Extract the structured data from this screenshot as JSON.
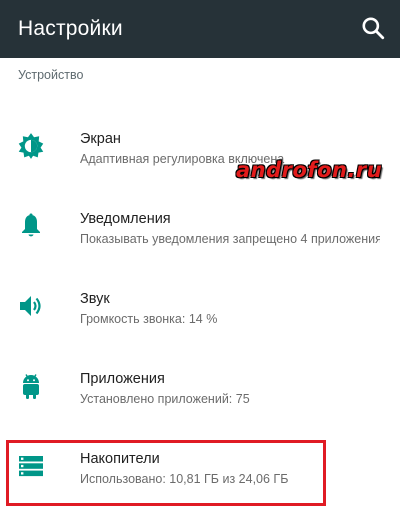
{
  "app_bar": {
    "title": "Настройки",
    "background": "#263238",
    "search_icon": "search-icon"
  },
  "section": {
    "title": "Устройство"
  },
  "items": [
    {
      "label": "Экран",
      "summary": "Адаптивная регулировка включена",
      "icon": "brightness-icon"
    },
    {
      "label": "Уведомления",
      "summary": "Показывать уведомления запрещено 4 приложениям",
      "icon": "bell-icon"
    },
    {
      "label": "Звук",
      "summary": "Громкость звонка: 14 %",
      "icon": "volume-icon"
    },
    {
      "label": "Приложения",
      "summary": "Установлено приложений: 75",
      "icon": "android-icon"
    },
    {
      "label": "Накопители",
      "summary": "Использовано: 10,81 ГБ из 24,06 ГБ",
      "icon": "storage-icon"
    }
  ],
  "watermark": "androfon.ru",
  "colors": {
    "accent": "#009688",
    "highlight": "#e01b24",
    "watermark": "#e21b1b"
  }
}
